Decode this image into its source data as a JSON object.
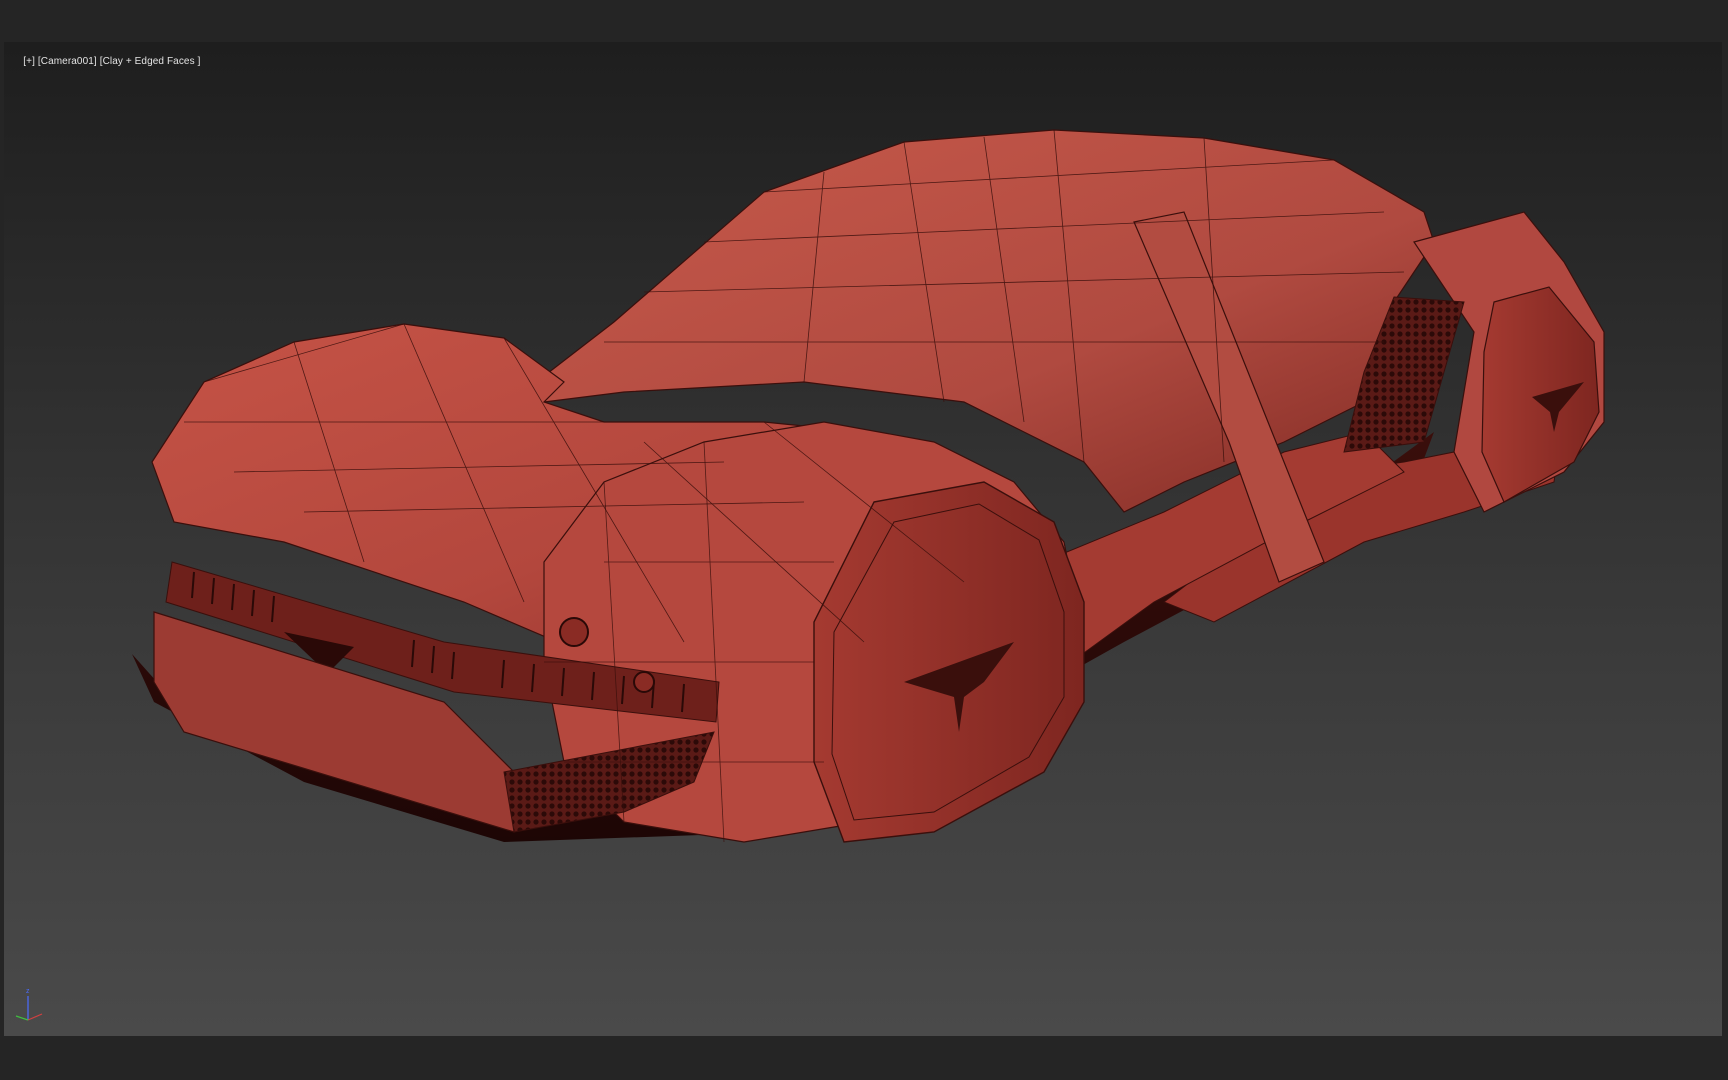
{
  "viewport": {
    "label_plus": "[+]",
    "label_camera": "[Camera001]",
    "label_shading": "[Clay + Edged Faces ]",
    "gizmo": {
      "z_label": "z",
      "x_color": "#d04040",
      "y_color": "#3fbf3f",
      "z_color": "#4a6cff"
    }
  },
  "colors": {
    "app_background": "#252525",
    "model_clay": "#b8493f",
    "model_edge": "#3a0f0c"
  }
}
